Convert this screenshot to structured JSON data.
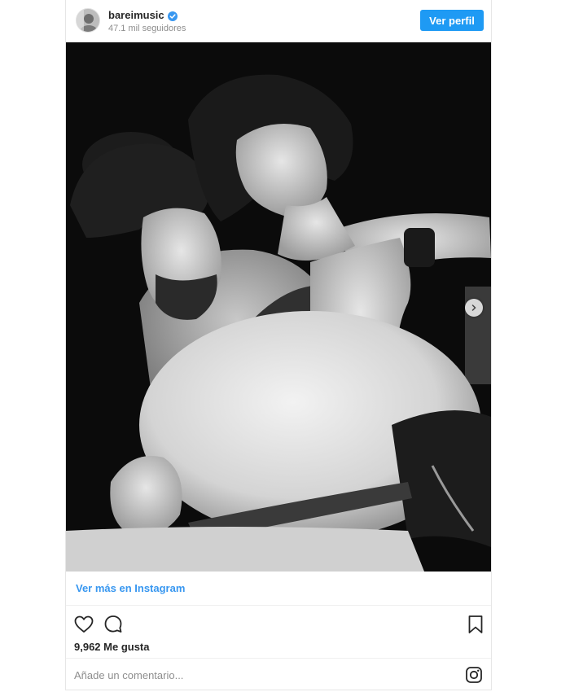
{
  "header": {
    "username": "bareimusic",
    "verified": true,
    "followers": "47.1 mil seguidores",
    "profile_button": "Ver perfil"
  },
  "post": {
    "image_type": "black-and-white photograph",
    "carousel": true,
    "view_more_link": "Ver más en Instagram",
    "likes": "9,962 Me gusta"
  },
  "comment": {
    "placeholder": "Añade un comentario..."
  },
  "icons": {
    "verified": "verified-badge-icon",
    "next": "chevron-right-icon",
    "like": "heart-icon",
    "comment": "comment-bubble-icon",
    "save": "bookmark-icon",
    "logo": "instagram-logo-icon"
  },
  "colors": {
    "accent": "#3897f0",
    "button": "#1e9af4",
    "text": "#262626",
    "muted": "#8e8e8e"
  }
}
